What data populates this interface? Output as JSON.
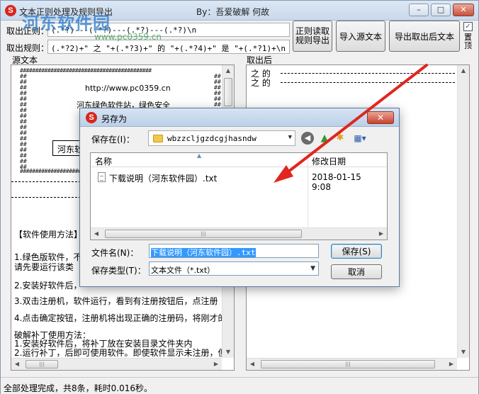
{
  "window": {
    "title": "文本正则处理及规则导出",
    "author": "By：吾爱破解  何故",
    "watermark": "河东软件园",
    "watermark_url": "www.pc0359.cn",
    "minimize": "–",
    "maximize": "□",
    "close": "✕"
  },
  "rules": {
    "extract_label": "取出正则：",
    "extract_value": "(.*?)---(.*?)---(.*?)---(.*?)\\n",
    "output_label": "取出规则：",
    "output_value": "(.*?2)+\" 之 \"+(.*?3)+\" 的 \"+(.*?4)+\" 是 \"+(.*?1)+\\n"
  },
  "toolbar": {
    "regex_extract_line1": "正则读取",
    "regex_extract_line2": "规则导出",
    "import_source": "导入源文本",
    "export_result": "导出取出后文本",
    "checkbox_label": "置顶",
    "checkbox_checked": true
  },
  "source_pane": {
    "label": "源文本",
    "hash_line": "###########################################",
    "lines": [
      "http://www.pc0359.cn",
      "河东绿色软件站，绿色安全",
      "河东软",
      "【软件使用方法】",
      "1.绿色版软件，不",
      "  请先要运行该类",
      "2.安装好软件后，",
      "3.双击注册机，软件运行，看到有注册按钮后，点注册",
      "4.点击确定按钮，注册机将出现正确的注册码，将刚才的",
      "破解补丁使用方法：",
      "1.安装好软件后，将补丁放在安装目录文件夹内",
      "2.运行补丁，后即可使用软件。即使软件显示未注册，但"
    ]
  },
  "result_pane": {
    "label": "取出后",
    "lines": [
      "之 的 ",
      "之 的 "
    ]
  },
  "status": {
    "text": "全部处理完成，共8条，耗时0.016秒。"
  },
  "dialog": {
    "title": "另存为",
    "close": "✕",
    "save_in_label": "保存在(I)：",
    "folder": "wbzzcljgzdcgjhasndw",
    "columns": {
      "name": "名称",
      "date": "修改日期"
    },
    "files": [
      {
        "name": "下载说明（河东软件园）.txt",
        "date": "2018-01-15 9:08"
      }
    ],
    "filename_label": "文件名(N)：",
    "filename_value": "下载说明（河东软件园）.txt",
    "filetype_label": "保存类型(T)：",
    "filetype_value": "文本文件（*.txt）",
    "save_button": "保存(S)",
    "cancel_button": "取消"
  },
  "colors": {
    "annotation_arrow": "#e0261f",
    "selection": "#3399ff",
    "watermark": "#2878c8"
  }
}
